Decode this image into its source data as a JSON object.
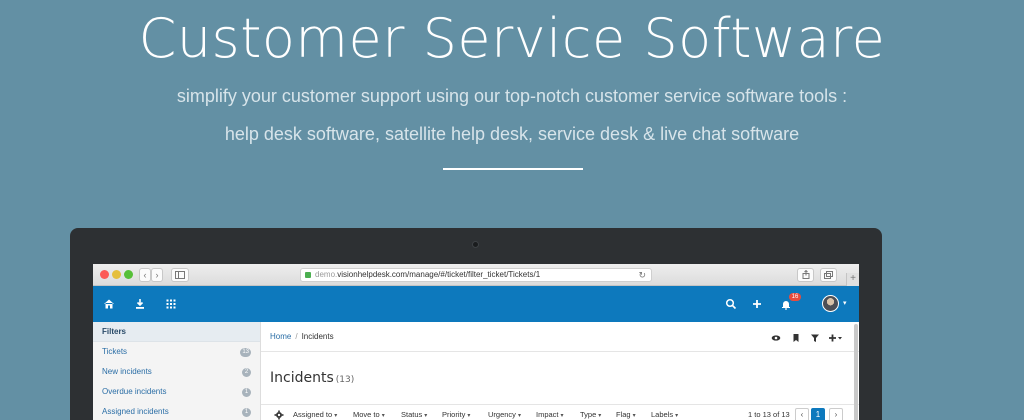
{
  "hero": {
    "title": "Customer Service Software",
    "subtitle_line1": "simplify your customer support using our top-notch customer service software tools :",
    "subtitle_line2": "help desk software, satellite help desk, service desk & live chat software"
  },
  "browser": {
    "url_host": "demo.",
    "url_rest": "visionhelpdesk.com/manage/#/ticket/filter_ticket/Tickets/1",
    "back_label": "‹",
    "forward_label": "›",
    "new_tab_label": "+"
  },
  "app_header": {
    "notification_count": "16",
    "icons": [
      "home-icon",
      "download-icon",
      "apps-grid-icon",
      "search-icon",
      "plus-icon",
      "bell-icon"
    ]
  },
  "sidebar": {
    "title": "Filters",
    "items": [
      {
        "label": "Tickets",
        "count": "13"
      },
      {
        "label": "New incidents",
        "count": "2"
      },
      {
        "label": "Overdue incidents",
        "count": "1"
      },
      {
        "label": "Assigned incidents",
        "count": "1"
      }
    ]
  },
  "main": {
    "breadcrumb_home": "Home",
    "breadcrumb_sep": "/",
    "breadcrumb_current": "Incidents",
    "title": "Incidents",
    "title_count": "(13)",
    "filters": [
      "Assigned to",
      "Move to",
      "Status",
      "Priority",
      "Urgency",
      "Impact",
      "Type",
      "Flag",
      "Labels"
    ],
    "pager_text": "1 to 13 of 13",
    "pager_prev": "‹",
    "pager_current": "1",
    "pager_next": "›"
  },
  "colors": {
    "page_bg": "#6390a4",
    "app_header": "#0d79bd",
    "notification_badge": "#e84c3d"
  }
}
